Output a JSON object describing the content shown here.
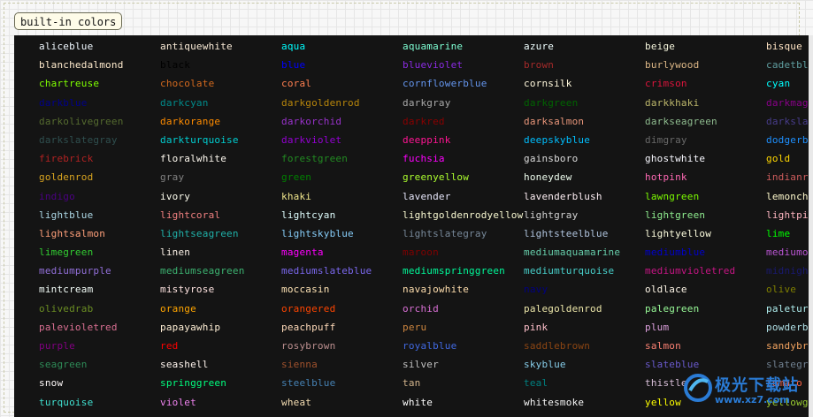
{
  "tab_label": "built-in colors",
  "watermark": {
    "text": "极光下载站",
    "sub": "www.xz7.com"
  },
  "colors": [
    {
      "name": "aliceblue",
      "color": "#f0f8ff"
    },
    {
      "name": "antiquewhite",
      "color": "#faebd7"
    },
    {
      "name": "aqua",
      "color": "#00ffff"
    },
    {
      "name": "aquamarine",
      "color": "#7fffd4"
    },
    {
      "name": "azure",
      "color": "#f0ffff"
    },
    {
      "name": "beige",
      "color": "#f5f5dc"
    },
    {
      "name": "bisque",
      "color": "#ffe4c4"
    },
    {
      "name": "blanchedalmond",
      "color": "#ffebcd"
    },
    {
      "name": "black",
      "color": "#000000"
    },
    {
      "name": "blue",
      "color": "#0000ff"
    },
    {
      "name": "blueviolet",
      "color": "#8a2be2"
    },
    {
      "name": "brown",
      "color": "#a52a2a"
    },
    {
      "name": "burlywood",
      "color": "#deb887"
    },
    {
      "name": "cadetblue",
      "color": "#5f9ea0"
    },
    {
      "name": "chartreuse",
      "color": "#7fff00"
    },
    {
      "name": "chocolate",
      "color": "#d2691e"
    },
    {
      "name": "coral",
      "color": "#ff7f50"
    },
    {
      "name": "cornflowerblue",
      "color": "#6495ed"
    },
    {
      "name": "cornsilk",
      "color": "#fff8dc"
    },
    {
      "name": "crimson",
      "color": "#dc143c"
    },
    {
      "name": "cyan",
      "color": "#00ffff"
    },
    {
      "name": "darkblue",
      "color": "#00008b"
    },
    {
      "name": "darkcyan",
      "color": "#008b8b"
    },
    {
      "name": "darkgoldenrod",
      "color": "#b8860b"
    },
    {
      "name": "darkgray",
      "color": "#a9a9a9"
    },
    {
      "name": "darkgreen",
      "color": "#006400"
    },
    {
      "name": "darkkhaki",
      "color": "#bdb76b"
    },
    {
      "name": "darkmagenta",
      "color": "#8b008b"
    },
    {
      "name": "darkolivegreen",
      "color": "#556b2f"
    },
    {
      "name": "darkorange",
      "color": "#ff8c00"
    },
    {
      "name": "darkorchid",
      "color": "#9932cc"
    },
    {
      "name": "darkred",
      "color": "#8b0000"
    },
    {
      "name": "darksalmon",
      "color": "#e9967a"
    },
    {
      "name": "darkseagreen",
      "color": "#8fbc8f"
    },
    {
      "name": "darkslateblue",
      "color": "#483d8b"
    },
    {
      "name": "darkslategray",
      "color": "#2f4f4f"
    },
    {
      "name": "darkturquoise",
      "color": "#00ced1"
    },
    {
      "name": "darkviolet",
      "color": "#9400d3"
    },
    {
      "name": "deeppink",
      "color": "#ff1493"
    },
    {
      "name": "deepskyblue",
      "color": "#00bfff"
    },
    {
      "name": "dimgray",
      "color": "#696969"
    },
    {
      "name": "dodgerblue",
      "color": "#1e90ff"
    },
    {
      "name": "firebrick",
      "color": "#b22222"
    },
    {
      "name": "floralwhite",
      "color": "#fffaf0"
    },
    {
      "name": "forestgreen",
      "color": "#228b22"
    },
    {
      "name": "fuchsia",
      "color": "#ff00ff"
    },
    {
      "name": "gainsboro",
      "color": "#dcdcdc"
    },
    {
      "name": "ghostwhite",
      "color": "#f8f8ff"
    },
    {
      "name": "gold",
      "color": "#ffd700"
    },
    {
      "name": "goldenrod",
      "color": "#daa520"
    },
    {
      "name": "gray",
      "color": "#808080"
    },
    {
      "name": "green",
      "color": "#008000"
    },
    {
      "name": "greenyellow",
      "color": "#adff2f"
    },
    {
      "name": "honeydew",
      "color": "#f0fff0"
    },
    {
      "name": "hotpink",
      "color": "#ff69b4"
    },
    {
      "name": "indianred",
      "color": "#cd5c5c"
    },
    {
      "name": "indigo",
      "color": "#4b0082"
    },
    {
      "name": "ivory",
      "color": "#fffff0"
    },
    {
      "name": "khaki",
      "color": "#f0e68c"
    },
    {
      "name": "lavender",
      "color": "#e6e6fa"
    },
    {
      "name": "lavenderblush",
      "color": "#fff0f5"
    },
    {
      "name": "lawngreen",
      "color": "#7cfc00"
    },
    {
      "name": "lemonchiffon",
      "color": "#fffacd"
    },
    {
      "name": "lightblue",
      "color": "#add8e6"
    },
    {
      "name": "lightcoral",
      "color": "#f08080"
    },
    {
      "name": "lightcyan",
      "color": "#e0ffff"
    },
    {
      "name": "lightgoldenrodyellow",
      "color": "#fafad2"
    },
    {
      "name": "lightgray",
      "color": "#d3d3d3"
    },
    {
      "name": "lightgreen",
      "color": "#90ee90"
    },
    {
      "name": "lightpink",
      "color": "#ffb6c1"
    },
    {
      "name": "lightsalmon",
      "color": "#ffa07a"
    },
    {
      "name": "lightseagreen",
      "color": "#20b2aa"
    },
    {
      "name": "lightskyblue",
      "color": "#87cefa"
    },
    {
      "name": "lightslategray",
      "color": "#778899"
    },
    {
      "name": "lightsteelblue",
      "color": "#b0c4de"
    },
    {
      "name": "lightyellow",
      "color": "#ffffe0"
    },
    {
      "name": "lime",
      "color": "#00ff00"
    },
    {
      "name": "limegreen",
      "color": "#32cd32"
    },
    {
      "name": "linen",
      "color": "#faf0e6"
    },
    {
      "name": "magenta",
      "color": "#ff00ff"
    },
    {
      "name": "maroon",
      "color": "#800000"
    },
    {
      "name": "mediumaquamarine",
      "color": "#66cdaa"
    },
    {
      "name": "mediumblue",
      "color": "#0000cd"
    },
    {
      "name": "mediumorchid",
      "color": "#ba55d3"
    },
    {
      "name": "mediumpurple",
      "color": "#9370db"
    },
    {
      "name": "mediumseagreen",
      "color": "#3cb371"
    },
    {
      "name": "mediumslateblue",
      "color": "#7b68ee"
    },
    {
      "name": "mediumspringgreen",
      "color": "#00fa9a"
    },
    {
      "name": "mediumturquoise",
      "color": "#48d1cc"
    },
    {
      "name": "mediumvioletred",
      "color": "#c71585"
    },
    {
      "name": "midnightblue",
      "color": "#191970"
    },
    {
      "name": "mintcream",
      "color": "#f5fffa"
    },
    {
      "name": "mistyrose",
      "color": "#ffe4e1"
    },
    {
      "name": "moccasin",
      "color": "#ffe4b5"
    },
    {
      "name": "navajowhite",
      "color": "#ffdead"
    },
    {
      "name": "navy",
      "color": "#000080"
    },
    {
      "name": "oldlace",
      "color": "#fdf5e6"
    },
    {
      "name": "olive",
      "color": "#808000"
    },
    {
      "name": "olivedrab",
      "color": "#6b8e23"
    },
    {
      "name": "orange",
      "color": "#ffa500"
    },
    {
      "name": "orangered",
      "color": "#ff4500"
    },
    {
      "name": "orchid",
      "color": "#da70d6"
    },
    {
      "name": "palegoldenrod",
      "color": "#eee8aa"
    },
    {
      "name": "palegreen",
      "color": "#98fb98"
    },
    {
      "name": "paleturquoise",
      "color": "#afeeee"
    },
    {
      "name": "palevioletred",
      "color": "#db7093"
    },
    {
      "name": "papayawhip",
      "color": "#ffefd5"
    },
    {
      "name": "peachpuff",
      "color": "#ffdab9"
    },
    {
      "name": "peru",
      "color": "#cd853f"
    },
    {
      "name": "pink",
      "color": "#ffc0cb"
    },
    {
      "name": "plum",
      "color": "#dda0dd"
    },
    {
      "name": "powderblue",
      "color": "#b0e0e6"
    },
    {
      "name": "purple",
      "color": "#800080"
    },
    {
      "name": "red",
      "color": "#ff0000"
    },
    {
      "name": "rosybrown",
      "color": "#bc8f8f"
    },
    {
      "name": "royalblue",
      "color": "#4169e1"
    },
    {
      "name": "saddlebrown",
      "color": "#8b4513"
    },
    {
      "name": "salmon",
      "color": "#fa8072"
    },
    {
      "name": "sandybrown",
      "color": "#f4a460"
    },
    {
      "name": "seagreen",
      "color": "#2e8b57"
    },
    {
      "name": "seashell",
      "color": "#fff5ee"
    },
    {
      "name": "sienna",
      "color": "#a0522d"
    },
    {
      "name": "silver",
      "color": "#c0c0c0"
    },
    {
      "name": "skyblue",
      "color": "#87ceeb"
    },
    {
      "name": "slateblue",
      "color": "#6a5acd"
    },
    {
      "name": "slategray",
      "color": "#708090"
    },
    {
      "name": "snow",
      "color": "#fffafa"
    },
    {
      "name": "springgreen",
      "color": "#00ff7f"
    },
    {
      "name": "steelblue",
      "color": "#4682b4"
    },
    {
      "name": "tan",
      "color": "#d2b48c"
    },
    {
      "name": "teal",
      "color": "#008080"
    },
    {
      "name": "thistle",
      "color": "#d8bfd8"
    },
    {
      "name": "tomato",
      "color": "#ff6347"
    },
    {
      "name": "turquoise",
      "color": "#40e0d0"
    },
    {
      "name": "violet",
      "color": "#ee82ee"
    },
    {
      "name": "wheat",
      "color": "#f5deb3"
    },
    {
      "name": "white",
      "color": "#ffffff"
    },
    {
      "name": "whitesmoke",
      "color": "#f5f5f5"
    },
    {
      "name": "yellow",
      "color": "#ffff00"
    },
    {
      "name": "yellowgreen",
      "color": "#9acd32"
    }
  ]
}
